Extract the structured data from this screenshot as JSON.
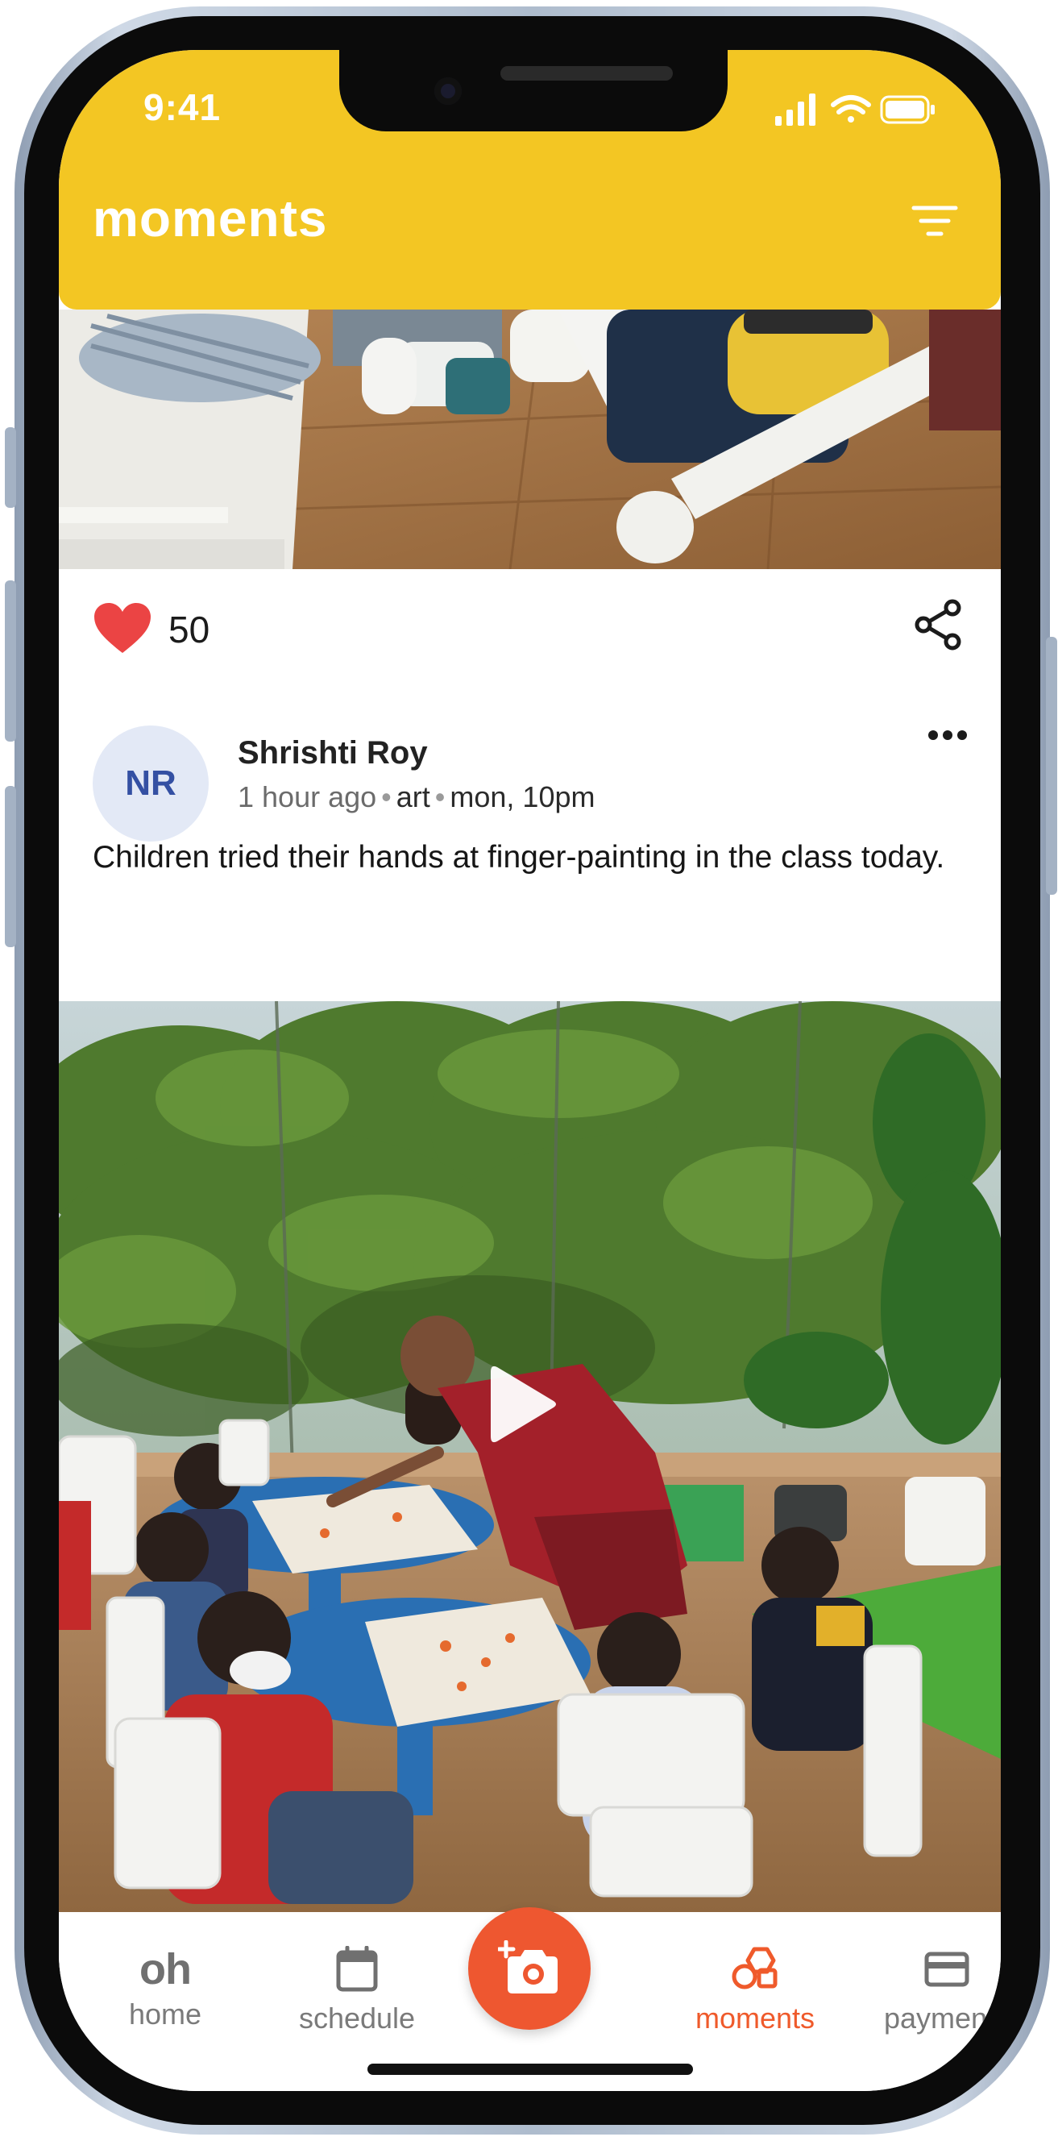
{
  "status_bar": {
    "time": "9:41"
  },
  "header": {
    "title": "moments",
    "filter_icon": "filter-icon"
  },
  "post_actions": {
    "like_count": "50",
    "like_icon": "heart-icon",
    "share_icon": "share-icon"
  },
  "post": {
    "avatar_initials": "NR",
    "author": "Shrishti Roy",
    "time_ago": "1 hour ago",
    "tag": "art",
    "when": "mon, 10pm",
    "caption": "Children tried their hands at finger-painting in the class today.",
    "more_icon": "more-dots-icon",
    "media_icon": "play-icon"
  },
  "bottom_nav": {
    "items": [
      {
        "logo": "oh",
        "label": "home"
      },
      {
        "icon": "calendar-icon",
        "label": "schedule"
      },
      {
        "icon": "moments-icon",
        "label": "moments",
        "active": true
      },
      {
        "icon": "card-icon",
        "label": "payments"
      }
    ],
    "fab_icon": "add-photo-icon"
  },
  "colors": {
    "brand_yellow": "#f3c623",
    "accent_orange": "#ee5730",
    "like_red": "#eb4444"
  }
}
